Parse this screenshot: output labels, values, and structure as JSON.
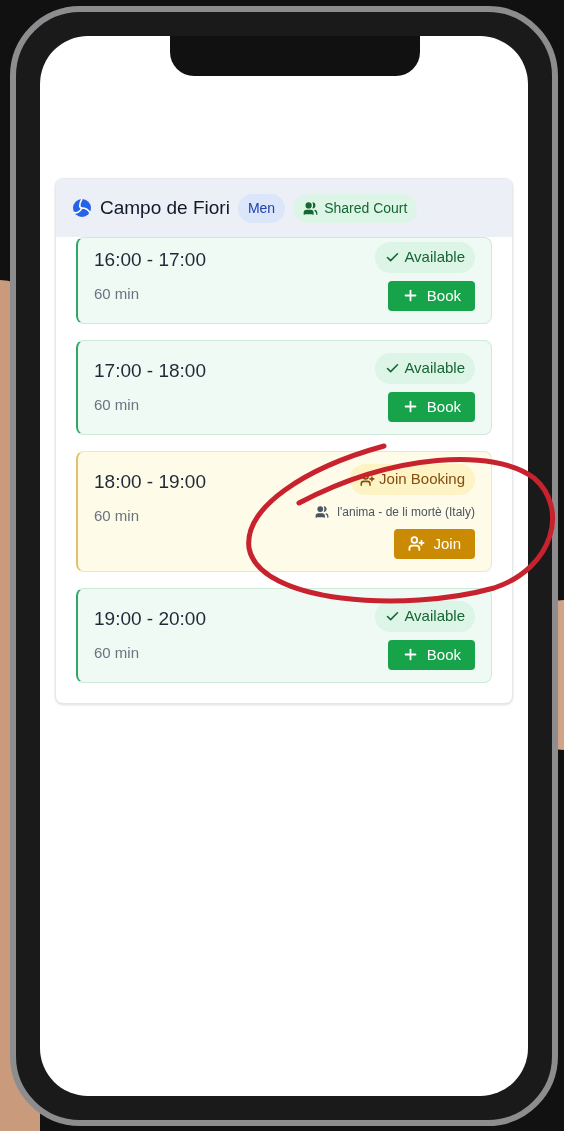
{
  "venue": {
    "name": "Campo de Fiori",
    "category": "Men",
    "court_type": "Shared Court"
  },
  "slots": [
    {
      "kind": "available",
      "time": "16:00 - 17:00",
      "duration": "60 min",
      "status": "Available",
      "action": "Book"
    },
    {
      "kind": "available",
      "time": "17:00 - 18:00",
      "duration": "60 min",
      "status": "Available",
      "action": "Book"
    },
    {
      "kind": "join",
      "time": "18:00 - 19:00",
      "duration": "60 min",
      "status": "Join Booking",
      "team": "l'anima - de li mortè (Italy)",
      "action": "Join"
    },
    {
      "kind": "available",
      "time": "19:00 - 20:00",
      "duration": "60 min",
      "status": "Available",
      "action": "Book"
    }
  ]
}
